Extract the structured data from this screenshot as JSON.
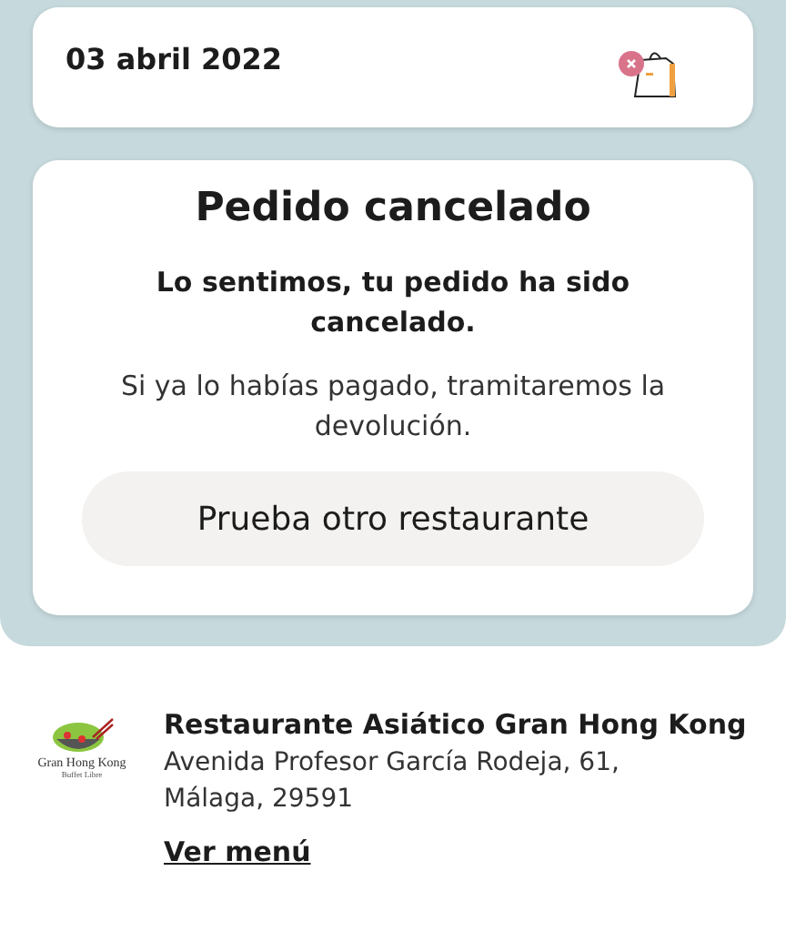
{
  "order": {
    "date": "03 abril 2022"
  },
  "status": {
    "title": "Pedido cancelado",
    "message": "Lo sentimos, tu pedido ha sido cancelado.",
    "note": "Si ya lo habías pagado, tramitaremos la devolución.",
    "button": "Prueba otro restaurante"
  },
  "restaurant": {
    "logo_name": "Gran Hong Kong",
    "logo_tagline": "Buffet Libre",
    "name": "Restaurante Asiático Gran Hong Kong",
    "address": "Avenida Profesor García Rodeja, 61, Málaga, 29591",
    "link": "Ver menú"
  }
}
